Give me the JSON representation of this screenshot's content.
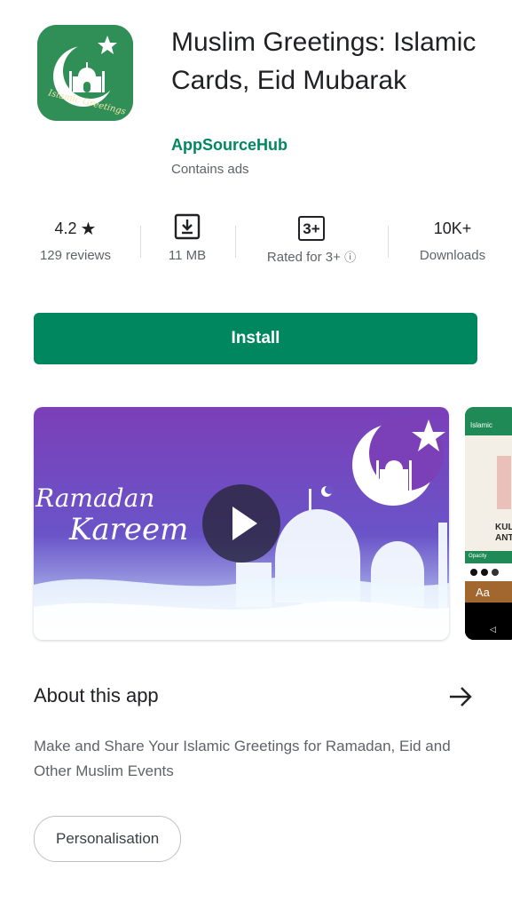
{
  "app": {
    "title": "Muslim Greetings: Islamic Cards, Eid Mubarak",
    "developer": "AppSourceHub",
    "ads_notice": "Contains ads",
    "icon_text": "Islamic Greetings",
    "icon_bg": "#2f8f57"
  },
  "stats": {
    "rating": "4.2",
    "rating_star": "★",
    "reviews": "129 reviews",
    "size": "11 MB",
    "content_rating": "3+",
    "content_rating_label": "Rated for 3+",
    "info_icon": "ⓘ",
    "downloads": "10K+",
    "downloads_label": "Downloads"
  },
  "install": {
    "label": "Install",
    "color": "#01875f"
  },
  "media": {
    "video_text_line1": "Ramadan",
    "video_text_line2": "Kareem",
    "screenshot2_header": "Islamic",
    "screenshot2_text1": "KUL",
    "screenshot2_text2": "ANT",
    "screenshot2_opacity": "Opacity",
    "screenshot2_aa": "Aa"
  },
  "about": {
    "title": "About this app",
    "arrow_icon": "arrow-right-icon",
    "description": "Make and Share Your Islamic Greetings for Ramadan, Eid and Other Muslim Events"
  },
  "tags": [
    "Personalisation"
  ]
}
